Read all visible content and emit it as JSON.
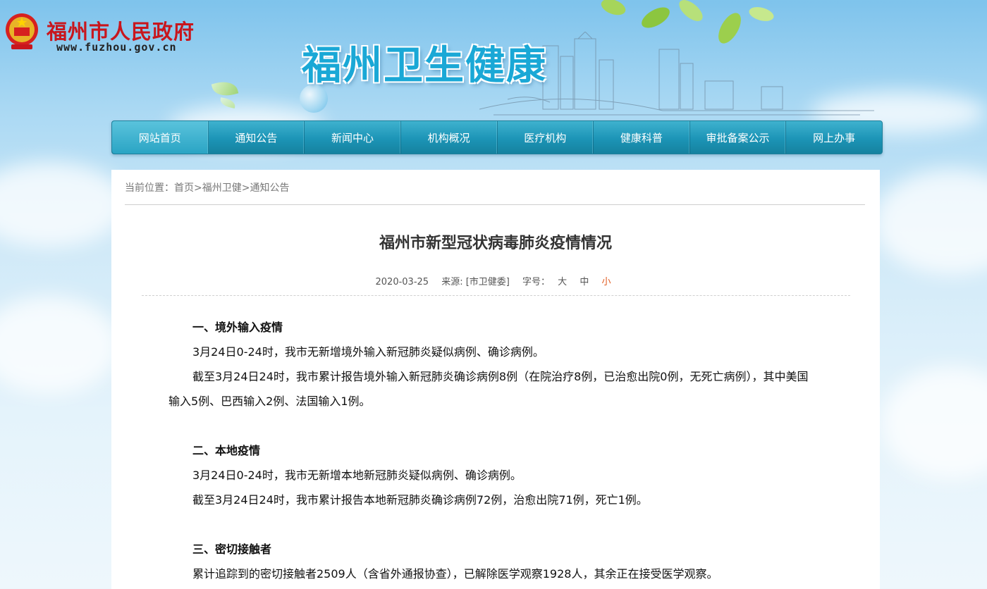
{
  "header": {
    "site_name": "福州市人民政府",
    "site_url": "www.fuzhou.gov.cn",
    "banner_title": "福州卫生健康"
  },
  "nav": {
    "items": [
      {
        "label": "网站首页"
      },
      {
        "label": "通知公告"
      },
      {
        "label": "新闻中心"
      },
      {
        "label": "机构概况"
      },
      {
        "label": "医疗机构"
      },
      {
        "label": "健康科普"
      },
      {
        "label": "审批备案公示"
      },
      {
        "label": "网上办事"
      }
    ]
  },
  "breadcrumb": {
    "prefix": "当前位置：",
    "items": [
      "首页",
      "福州卫健",
      "通知公告"
    ],
    "separator": ">"
  },
  "article": {
    "title": "福州市新型冠状病毒肺炎疫情情况",
    "date": "2020-03-25",
    "source": "来源: [市卫健委]",
    "font_size_label": "字号：",
    "font_sizes": [
      "大",
      "中",
      "小"
    ],
    "sections": [
      {
        "heading": "一、境外输入疫情",
        "paragraphs": [
          "3月24日0-24时，我市无新增境外输入新冠肺炎疑似病例、确诊病例。",
          "截至3月24日24时，我市累计报告境外输入新冠肺炎确诊病例8例（在院治疗8例，已治愈出院0例，无死亡病例），其中美国输入5例、巴西输入2例、法国输入1例。"
        ]
      },
      {
        "heading": "二、本地疫情",
        "paragraphs": [
          "3月24日0-24时，我市无新增本地新冠肺炎疑似病例、确诊病例。",
          "截至3月24日24时，我市累计报告本地新冠肺炎确诊病例72例，治愈出院71例，死亡1例。"
        ]
      },
      {
        "heading": "三、密切接触者",
        "paragraphs": [
          "累计追踪到的密切接触者2509人（含省外通报协查），已解除医学观察1928人，其余正在接受医学观察。"
        ]
      }
    ]
  },
  "colors": {
    "nav_bg": "#1c94b6",
    "site_name": "#c8161d",
    "banner_title": "#1aa8d6",
    "active_font_size": "#e15a1e"
  }
}
